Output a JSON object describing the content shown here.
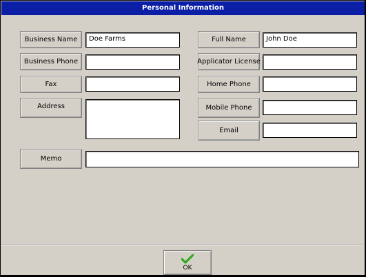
{
  "window": {
    "title": "Personal Information"
  },
  "left": {
    "business_name": {
      "label": "Business Name",
      "value": "Doe Farms"
    },
    "business_phone": {
      "label": "Business Phone",
      "value": ""
    },
    "fax": {
      "label": "Fax",
      "value": ""
    },
    "address": {
      "label": "Address",
      "value": ""
    }
  },
  "right": {
    "full_name": {
      "label": "Full Name",
      "value": "John Doe"
    },
    "applicator_license": {
      "label": "Applicator License",
      "value": ""
    },
    "home_phone": {
      "label": "Home Phone",
      "value": ""
    },
    "mobile_phone": {
      "label": "Mobile Phone",
      "value": ""
    },
    "email": {
      "label": "Email",
      "value": ""
    }
  },
  "memo": {
    "label": "Memo",
    "value": ""
  },
  "footer": {
    "ok_label": "OK",
    "ok_icon": "checkmark-icon",
    "ok_icon_color": "#2fa81c"
  },
  "colors": {
    "titlebar": "#0a1fa6",
    "background": "#d4d0c8"
  }
}
